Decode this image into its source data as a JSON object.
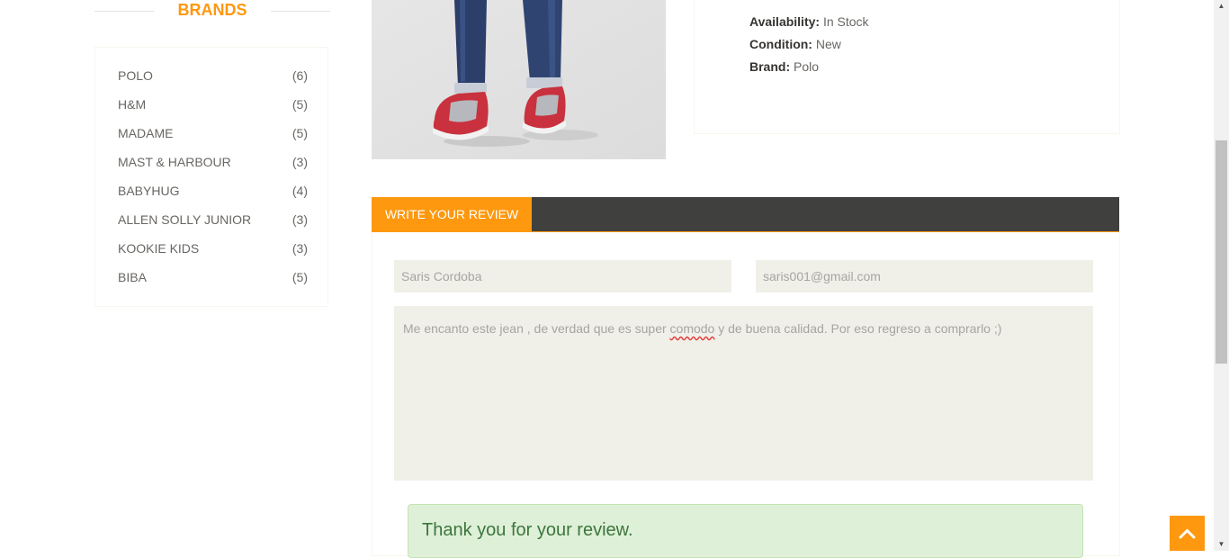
{
  "sidebar": {
    "brands_title": "Brands",
    "brands": [
      {
        "name": "POLO",
        "count": "(6)"
      },
      {
        "name": "H&M",
        "count": "(5)"
      },
      {
        "name": "MADAME",
        "count": "(5)"
      },
      {
        "name": "MAST & HARBOUR",
        "count": "(3)"
      },
      {
        "name": "BABYHUG",
        "count": "(4)"
      },
      {
        "name": "ALLEN SOLLY JUNIOR",
        "count": "(3)"
      },
      {
        "name": "KOOKIE KIDS",
        "count": "(3)"
      },
      {
        "name": "BIBA",
        "count": "(5)"
      }
    ]
  },
  "product": {
    "availability_label": "Availability:",
    "availability_value": "In Stock",
    "condition_label": "Condition:",
    "condition_value": "New",
    "brand_label": "Brand:",
    "brand_value": "Polo"
  },
  "review": {
    "tab_label": "Write Your Review",
    "name_value": "Saris Cordoba",
    "email_value": "saris001@gmail.com",
    "text_before": "Me encanto este jean , de verdad que es super ",
    "text_misspelled": "comodo",
    "text_after": " y de buena calidad. Por eso regreso a comprarlo ;)",
    "success_message": "Thank you for your review."
  },
  "colors": {
    "accent": "#FE980F",
    "tab_bar": "#40403E",
    "input_bg": "#F0F0E9",
    "success_bg": "#dff0d8",
    "success_text": "#3c763d"
  },
  "icons": {
    "scroll_to_top": "chevron-up-icon",
    "scrollbar_up": "triangle-up-icon",
    "scrollbar_down": "triangle-down-icon"
  }
}
